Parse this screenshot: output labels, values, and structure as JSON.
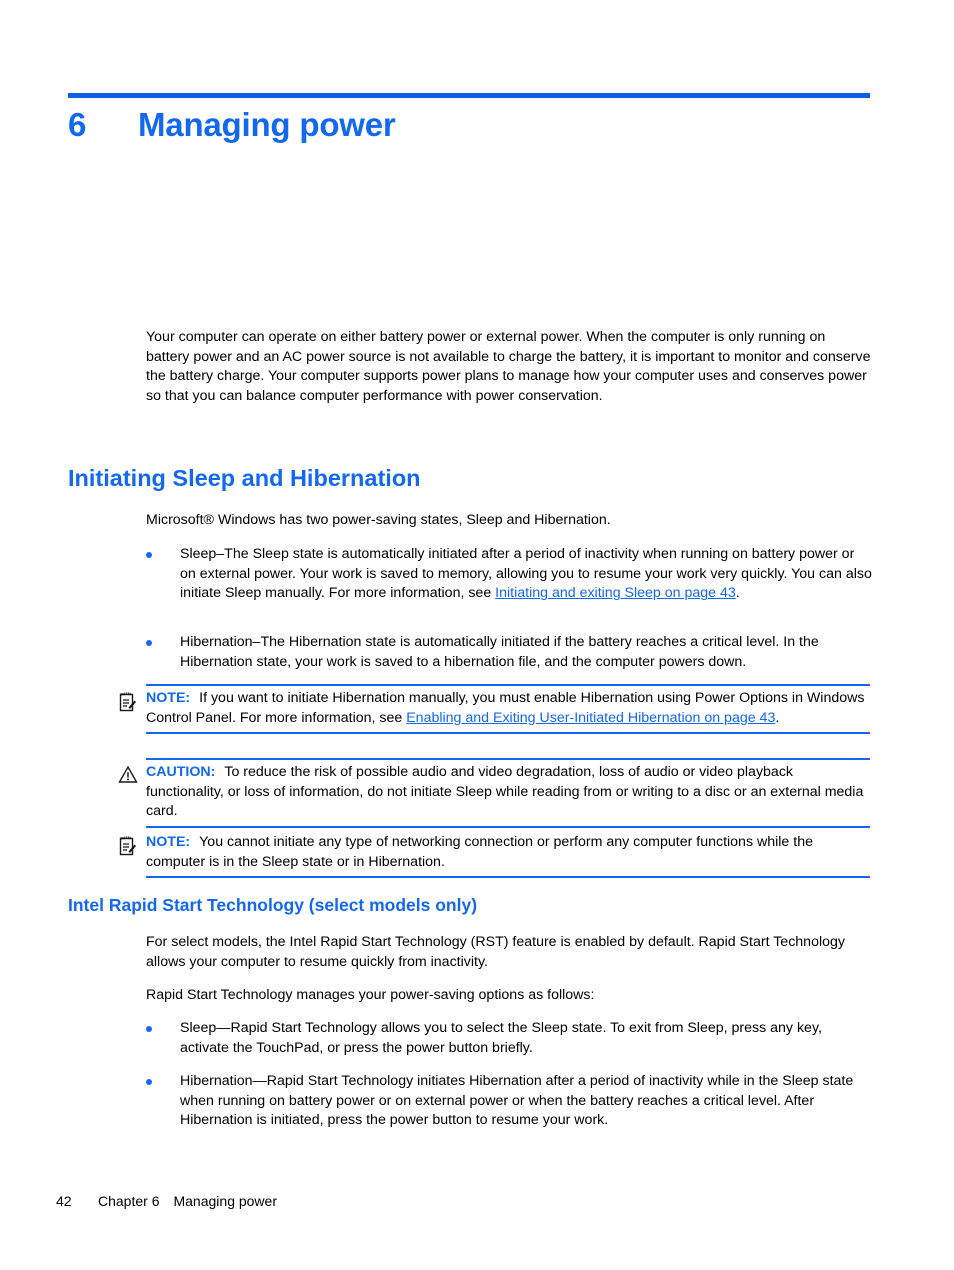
{
  "colors": {
    "accent_blue": "#1268f0",
    "rule_blue": "#0b60e6",
    "body_text": "#000000"
  },
  "chapter": {
    "number": "6",
    "title": "Managing power"
  },
  "intro_paragraph": "Your computer can operate on either battery power or external power. When the computer is only running on battery power and an AC power source is not available to charge the battery, it is important to monitor and conserve the battery charge. Your computer supports power plans to manage how your computer uses and conserves power so that you can balance computer performance with power conservation.",
  "section_sleep": {
    "heading": "Initiating Sleep and Hibernation",
    "intro": "Microsoft® Windows has two power-saving states, Sleep and Hibernation.",
    "bullet_sleep_part1": "Sleep–The Sleep state is automatically initiated after a period of inactivity when running on battery power or on external power. Your work is saved to memory, allowing you to resume your work very quickly. You can also initiate Sleep manually. For more information, see ",
    "bullet_sleep_link": "Initiating and exiting Sleep on page 43",
    "bullet_sleep_part2": ".",
    "bullet_hibernation": "Hibernation–The Hibernation state is automatically initiated if the battery reaches a critical level. In the Hibernation state, your work is saved to a hibernation file, and the computer powers down."
  },
  "note_1": {
    "icon": "note-pad-icon",
    "label": "NOTE:",
    "text_part1": "If you want to initiate Hibernation manually, you must enable Hibernation using Power Options in Windows Control Panel. For more information, see ",
    "link": "Enabling and Exiting User-Initiated Hibernation on page 43",
    "text_part2": "."
  },
  "caution_1": {
    "icon": "warning-triangle-icon",
    "label": "CAUTION:",
    "text": "To reduce the risk of possible audio and video degradation, loss of audio or video playback functionality, or loss of information, do not initiate Sleep while reading from or writing to a disc or an external media card."
  },
  "note_2": {
    "icon": "note-pad-icon",
    "label": "NOTE:",
    "text": "You cannot initiate any type of networking connection or perform any computer functions while the computer is in the Sleep state or in Hibernation."
  },
  "section_rst": {
    "heading": "Intel Rapid Start Technology (select models only)",
    "paragraph_1": "For select models, the Intel Rapid Start Technology (RST) feature is enabled by default. Rapid Start Technology allows your computer to resume quickly from inactivity.",
    "paragraph_2": "Rapid Start Technology manages your power-saving options as follows:",
    "bullet_sleep": "Sleep—Rapid Start Technology allows you to select the Sleep state. To exit from Sleep, press any key, activate the TouchPad, or press the power button briefly.",
    "bullet_hibernation": "Hibernation—Rapid Start Technology initiates Hibernation after a period of inactivity while in the Sleep state when running on battery power or on external power or when the battery reaches a critical level. After Hibernation is initiated, press the power button to resume your work."
  },
  "footer": {
    "page_number": "42",
    "chapter_label": "Chapter 6",
    "chapter_title": "Managing power"
  }
}
